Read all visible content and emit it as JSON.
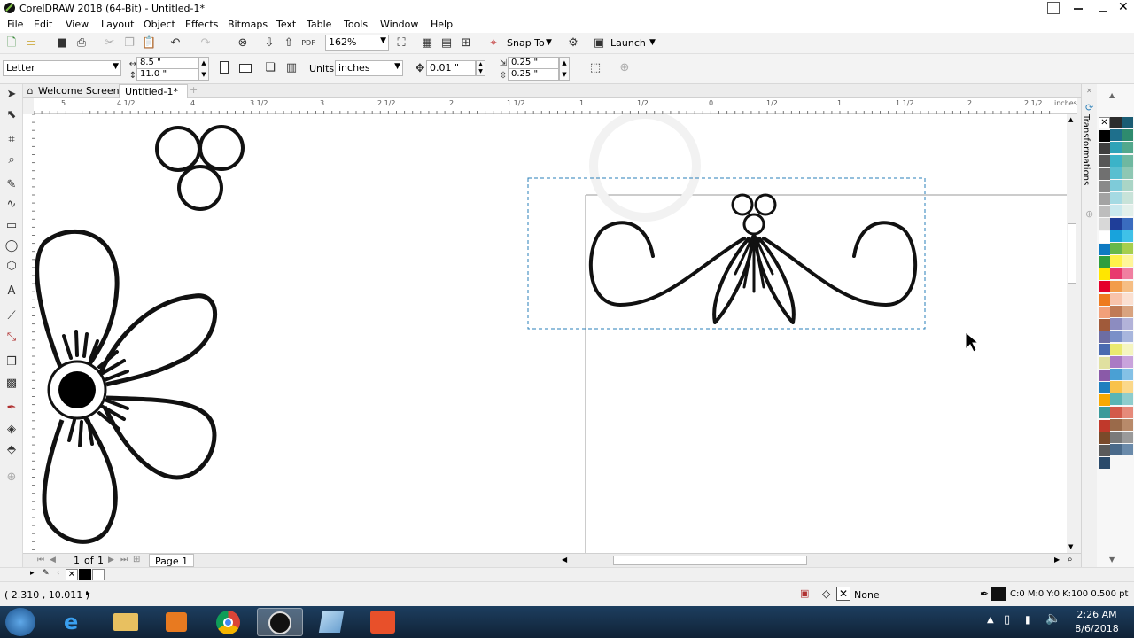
{
  "window": {
    "title": "CorelDRAW 2018 (64-Bit) - Untitled-1*"
  },
  "menu": [
    "File",
    "Edit",
    "View",
    "Layout",
    "Object",
    "Effects",
    "Bitmaps",
    "Text",
    "Table",
    "Tools",
    "Window",
    "Help"
  ],
  "toolbar": {
    "zoom": "162%",
    "snap_to": "Snap To",
    "launch": "Launch"
  },
  "property_bar": {
    "page_size": "Letter",
    "width": "8.5 \"",
    "height": "11.0 \"",
    "units_label": "Units:",
    "units": "inches",
    "nudge": "0.01 \"",
    "dup_x": "0.25 \"",
    "dup_y": "0.25 \""
  },
  "tabs": {
    "welcome": "Welcome Screen",
    "doc": "Untitled-1*"
  },
  "ruler": {
    "h_labels": [
      "5",
      "4 1/2",
      "4",
      "3 1/2",
      "3",
      "2 1/2",
      "2",
      "1 1/2",
      "1",
      "1/2",
      "0",
      "1/2",
      "1",
      "1 1/2",
      "2",
      "2 1/2"
    ],
    "units": "inches",
    "v_labels": [
      "11 1/2",
      "11",
      "10 1/2",
      "10",
      "9 1/2",
      "9",
      "8 1/2",
      "8"
    ]
  },
  "docker": {
    "label": "Transformations"
  },
  "page_nav": {
    "current": "1",
    "of": "of",
    "total": "1",
    "page_tab": "Page 1"
  },
  "status": {
    "coords": "( 2.310 , 10.011 )",
    "fill_label": "None",
    "outline_info": "C:0 M:0 Y:0 K:100  0.500 pt"
  },
  "clock": {
    "time": "2:26 AM",
    "date": "8/6/2018"
  },
  "palette_colors": [
    "#000000",
    "#2c2c2c",
    "#1a5c73",
    "#3f3f3f",
    "#1e6f8c",
    "#2e8b6e",
    "#575757",
    "#2fa3b8",
    "#52a88c",
    "#707070",
    "#3bb3c8",
    "#6fb8a0",
    "#8a8a8a",
    "#59bfd0",
    "#8ec7b3",
    "#a3a3a3",
    "#7ecbd9",
    "#aad5c6",
    "#bdbdbd",
    "#a5dae3",
    "#c8e3d9",
    "#d8d8d8",
    "#c9e8ee",
    "#e3f0eb",
    "#ffffff",
    "#1f3e99",
    "#3a6cbf",
    "#0d7ac2",
    "#18a3dc",
    "#3fc1e8",
    "#2e9e3e",
    "#66b84a",
    "#a6cf4d",
    "#ffe600",
    "#fff24a",
    "#fff699",
    "#e4002b",
    "#e83a6e",
    "#f07fa0",
    "#ee7a1e",
    "#f29c4a",
    "#f6be84",
    "#f2a07a",
    "#f8c3aa",
    "#fbe0d1",
    "#a05a3a",
    "#c07a55",
    "#d9a37f",
    "#6d6da3",
    "#8c8cc0",
    "#b3b3d9",
    "#4a6ab0",
    "#7a90c8",
    "#a8b6dd",
    "#e0e0a0",
    "#eaea70",
    "#f5f5c0",
    "#8a5aa8",
    "#aa7ac4",
    "#c9a3dc",
    "#1f7fbf",
    "#4aa0d4",
    "#84c1e6",
    "#f7a800",
    "#f9c24a",
    "#fbd88a",
    "#3a9a9a",
    "#5ab5b5",
    "#8ecdcd",
    "#c0392b",
    "#d35a4a",
    "#e68a7a",
    "#7a4a2a",
    "#9a6a4a",
    "#b88a6a",
    "#5a5a5a",
    "#7a7a7a",
    "#9a9a9a",
    "#2a4a6a",
    "#4a6a8a",
    "#6a8aaa"
  ]
}
